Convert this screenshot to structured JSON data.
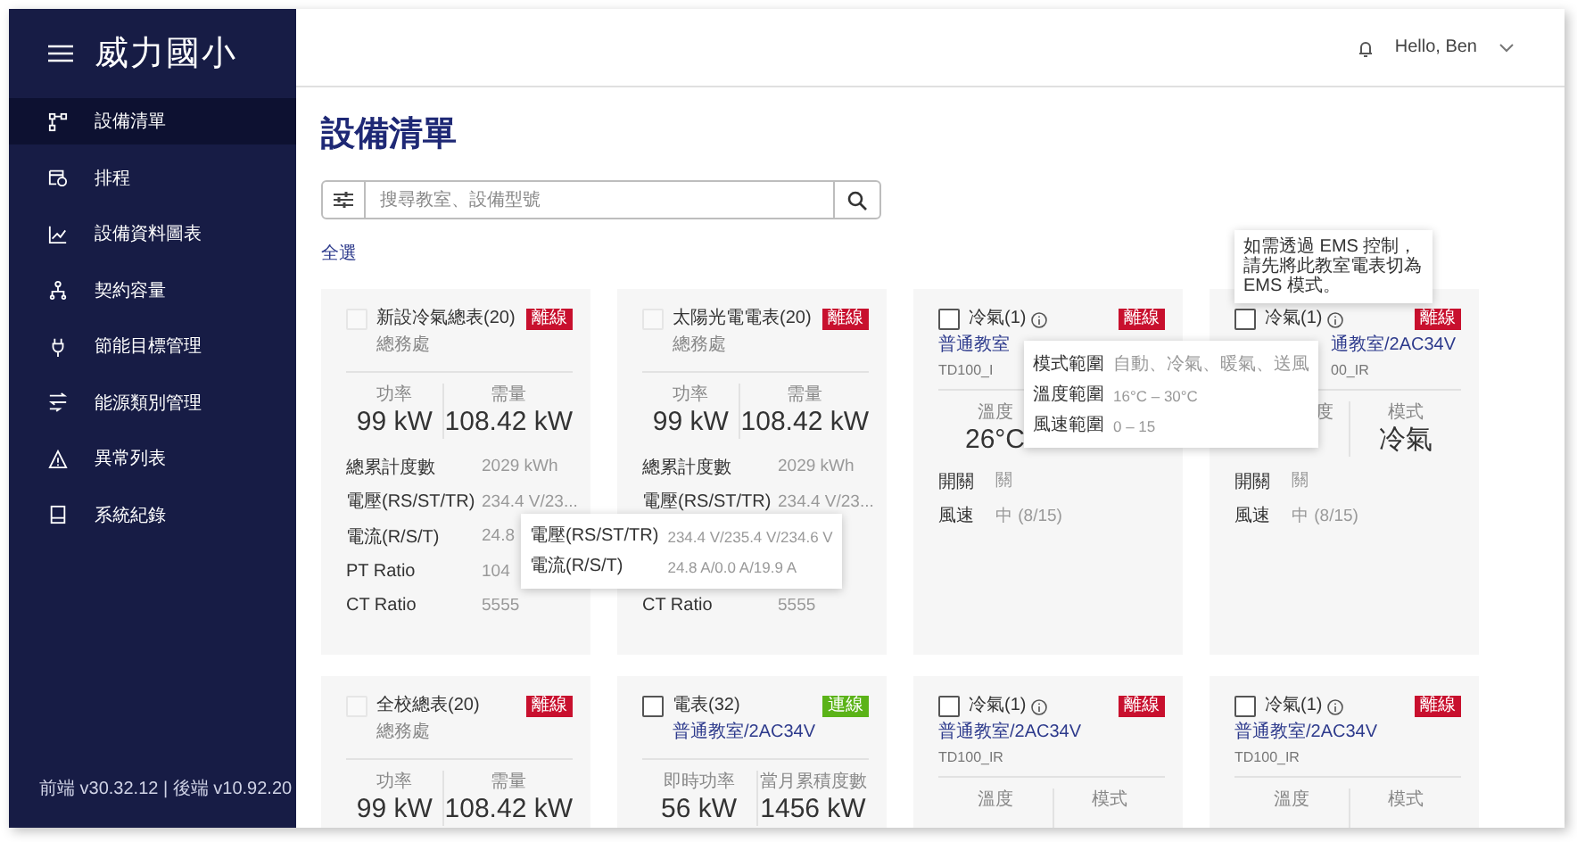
{
  "sidebar": {
    "title": "威力國小",
    "items": [
      {
        "label": "設備清單",
        "selected": true
      },
      {
        "label": "排程",
        "selected": false
      },
      {
        "label": "設備資料圖表",
        "selected": false
      },
      {
        "label": "契約容量",
        "selected": false
      },
      {
        "label": "節能目標管理",
        "selected": false
      },
      {
        "label": "能源類別管理",
        "selected": false
      },
      {
        "label": "異常列表",
        "selected": false
      },
      {
        "label": "系統紀錄",
        "selected": false
      }
    ],
    "footer": "前端 v30.32.12 | 後端 v10.92.20"
  },
  "header": {
    "greeting": "Hello, Ben"
  },
  "page": {
    "title": "設備清單",
    "search": {
      "placeholder": "搜尋教室、設備型號"
    },
    "select_all": "全選"
  },
  "cards": [
    {
      "kind": "meter",
      "title": "新設冷氣總表(20)",
      "checkbox": {
        "checked": false,
        "disabled": true
      },
      "status": {
        "kind": "offline",
        "text": "離線"
      },
      "department": "總務處",
      "metrics": [
        {
          "label": "功率",
          "value": "99 kW"
        },
        {
          "label": "需量",
          "value": "108.42 kW"
        }
      ],
      "rows": [
        {
          "label": "總累計度數",
          "value": "2029 kWh"
        },
        {
          "label": "電壓(RS/ST/TR)",
          "value": "234.4 V/23..."
        },
        {
          "label": "電流(R/S/T)",
          "value": "24.8"
        },
        {
          "label": "PT Ratio",
          "value": "104"
        },
        {
          "label": "CT Ratio",
          "value": "5555"
        }
      ],
      "tooltip": {
        "kind": "table",
        "rows": [
          {
            "label": "電壓(RS/ST/TR)",
            "value": "234.4 V/235.4 V/234.6 V"
          },
          {
            "label": "電流(R/S/T)",
            "value": "24.8 A/0.0 A/19.9 A"
          }
        ]
      }
    },
    {
      "kind": "meter",
      "title": "太陽光電電表(20)",
      "checkbox": {
        "checked": false,
        "disabled": true
      },
      "status": {
        "kind": "offline",
        "text": "離線"
      },
      "department": "總務處",
      "metrics": [
        {
          "label": "功率",
          "value": "99 kW"
        },
        {
          "label": "需量",
          "value": "108.42 kW"
        }
      ],
      "rows": [
        {
          "label": "總累計度數",
          "value": "2029 kWh"
        },
        {
          "label": "電壓(RS/ST/TR)",
          "value": "234.4 V/23..."
        },
        {
          "label": "CT Ratio",
          "value": "5555"
        }
      ]
    },
    {
      "kind": "ac",
      "title": "冷氣(1)",
      "info": true,
      "checkbox": {
        "checked": false,
        "disabled": false
      },
      "status": {
        "kind": "offline",
        "text": "離線"
      },
      "location": "普通教室",
      "model": "TD100_I",
      "metrics": [
        {
          "label": "溫度",
          "value": "26°C"
        }
      ],
      "rows": [
        {
          "label": "開關",
          "value": "關"
        },
        {
          "label": "風速",
          "value": "中 (8/15)"
        }
      ],
      "tooltip": {
        "kind": "table",
        "rows": [
          {
            "label": "模式範圍",
            "value": "自動、冷氣、暖氣、送風"
          },
          {
            "label": "溫度範圍",
            "value": "16°C – 30°C"
          },
          {
            "label": "風速範圍",
            "value": "0 – 15"
          }
        ]
      }
    },
    {
      "kind": "ac",
      "title": "冷氣(1)",
      "info": true,
      "checkbox": {
        "checked": false,
        "disabled": false
      },
      "status": {
        "kind": "offline",
        "text": "離線"
      },
      "location": "通教室/2AC34V",
      "model": "00_IR",
      "metrics": [
        {
          "label": "度"
        },
        {
          "label": "模式",
          "value": "冷氣"
        }
      ],
      "rows": [
        {
          "label": "開關",
          "value": "關"
        },
        {
          "label": "風速",
          "value": "中 (8/15)"
        }
      ],
      "tooltip": {
        "kind": "text",
        "text": "如需透過 EMS 控制，請先將此教室電表切為 EMS 模式。"
      }
    },
    {
      "kind": "meter",
      "title": "全校總表(20)",
      "checkbox": {
        "checked": false,
        "disabled": true
      },
      "status": {
        "kind": "offline",
        "text": "離線"
      },
      "department": "總務處",
      "metrics": [
        {
          "label": "功率",
          "value": "99 kW"
        },
        {
          "label": "需量",
          "value": "108.42 kW"
        }
      ]
    },
    {
      "kind": "meter",
      "title": "電表(32)",
      "checkbox": {
        "checked": false,
        "disabled": false
      },
      "status": {
        "kind": "online",
        "text": "連線"
      },
      "location": "普通教室/2AC34V",
      "metrics": [
        {
          "label": "即時功率",
          "value": "56 kW"
        },
        {
          "label": "當月累積度數",
          "value": "1456 kW"
        }
      ]
    },
    {
      "kind": "ac",
      "title": "冷氣(1)",
      "info": true,
      "checkbox": {
        "checked": false,
        "disabled": false
      },
      "status": {
        "kind": "offline",
        "text": "離線"
      },
      "location": "普通教室/2AC34V",
      "model": "TD100_IR",
      "metrics": [
        {
          "label": "溫度"
        },
        {
          "label": "模式"
        }
      ]
    },
    {
      "kind": "ac",
      "title": "冷氣(1)",
      "info": true,
      "checkbox": {
        "checked": false,
        "disabled": false
      },
      "status": {
        "kind": "offline",
        "text": "離線"
      },
      "location": "普通教室/2AC34V",
      "model": "TD100_IR",
      "metrics": [
        {
          "label": "溫度"
        },
        {
          "label": "模式"
        }
      ]
    }
  ]
}
